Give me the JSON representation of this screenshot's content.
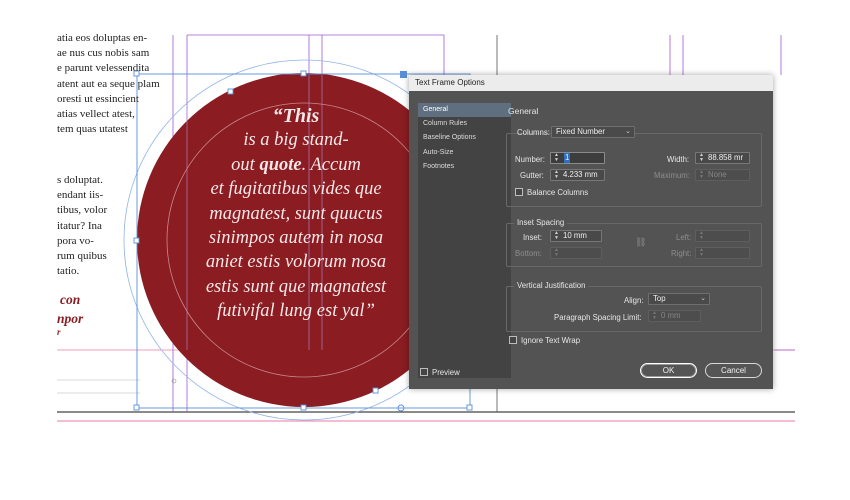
{
  "document": {
    "body_lines_top": [
      "atia eos doluptas en-",
      "ae nus cus nobis sam",
      "e parunt velessendita",
      "atent aut ea seque plam",
      "oresti ut essincient",
      "atias vellect atest,",
      "tem quas utatest"
    ],
    "body_lines_mid": [
      "s doluptat.",
      "endant iis-",
      "tibus, volor",
      "itatur? Ina",
      "pora vo-",
      "rum quibus",
      "tatio."
    ],
    "red_lines": [
      "con",
      "npor",
      "r"
    ],
    "quote_lines": [
      {
        "pre": "",
        "bold": "“This",
        "post": ""
      },
      {
        "pre": "is a big stand-",
        "bold": "",
        "post": ""
      },
      {
        "pre": "out ",
        "bold": "quote",
        "post": ". Accum"
      },
      {
        "pre": "et fugitatibus vides que",
        "bold": "",
        "post": ""
      },
      {
        "pre": "magnatest, sunt quucus",
        "bold": "",
        "post": ""
      },
      {
        "pre": "sinimpos autem in nosa",
        "bold": "",
        "post": ""
      },
      {
        "pre": "aniet estis volorum nosa",
        "bold": "",
        "post": ""
      },
      {
        "pre": "estis sunt que magnatest",
        "bold": "",
        "post": ""
      },
      {
        "pre": "futivifal lung est yal”",
        "bold": "",
        "post": ""
      }
    ],
    "colors": {
      "circle_fill": "#8a1c22",
      "guide_purple": "#a25ad1",
      "guide_pink": "#ee7aa8",
      "frame_blue": "#5a8fd8"
    }
  },
  "dialog": {
    "title": "Text Frame Options",
    "nav": [
      "General",
      "Column Rules",
      "Baseline Options",
      "Auto-Size",
      "Footnotes"
    ],
    "active_nav": "General",
    "section_title": "General",
    "columns": {
      "select_label": "Columns:",
      "select_value": "Fixed Number",
      "number_label": "Number:",
      "number_value": "1",
      "gutter_label": "Gutter:",
      "gutter_value": "4.233 mm",
      "width_label": "Width:",
      "width_value": "88.858 mr",
      "maximum_label": "Maximum:",
      "maximum_value": "None",
      "balance_label": "Balance Columns"
    },
    "inset": {
      "legend": "Inset Spacing",
      "inset_label": "Inset:",
      "inset_value": "10 mm",
      "bottom_label": "Bottom:",
      "left_label": "Left:",
      "right_label": "Right:"
    },
    "vertical": {
      "legend": "Vertical Justification",
      "align_label": "Align:",
      "align_value": "Top",
      "spacing_label": "Paragraph Spacing Limit:",
      "spacing_value": "0 mm"
    },
    "ignore_wrap_label": "Ignore Text Wrap",
    "preview_label": "Preview",
    "ok_label": "OK",
    "cancel_label": "Cancel"
  }
}
